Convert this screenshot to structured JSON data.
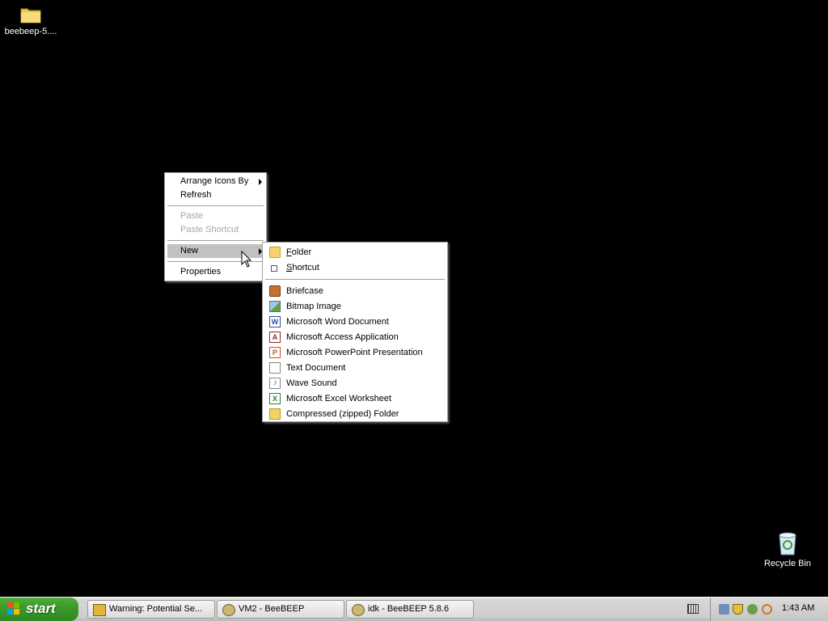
{
  "desktop": {
    "icons": [
      {
        "label": "beebeep-5....",
        "icon": "folder-icon"
      },
      {
        "label": "Recycle Bin",
        "icon": "recycle-bin-icon"
      }
    ]
  },
  "context_menu": {
    "items": [
      {
        "label": "Arrange Icons By",
        "submenu": true,
        "enabled": true
      },
      {
        "label": "Refresh",
        "enabled": true
      },
      {
        "label": "Paste",
        "enabled": false
      },
      {
        "label": "Paste Shortcut",
        "enabled": false
      },
      {
        "label": "New",
        "submenu": true,
        "enabled": true,
        "highlighted": true
      },
      {
        "label": "Properties",
        "enabled": true
      }
    ]
  },
  "new_submenu": {
    "items": [
      {
        "label": "Folder",
        "accel": "F",
        "rest": "older",
        "icon": "folder-icon"
      },
      {
        "label": "Shortcut",
        "accel": "S",
        "rest": "hortcut",
        "icon": "shortcut-icon"
      },
      {
        "label": "Briefcase",
        "icon": "briefcase-icon"
      },
      {
        "label": "Bitmap Image",
        "icon": "bitmap-icon"
      },
      {
        "label": "Microsoft Word Document",
        "icon": "word-icon"
      },
      {
        "label": "Microsoft Access Application",
        "icon": "access-icon"
      },
      {
        "label": "Microsoft PowerPoint Presentation",
        "icon": "powerpoint-icon"
      },
      {
        "label": "Text Document",
        "icon": "text-document-icon"
      },
      {
        "label": "Wave Sound",
        "icon": "wave-sound-icon"
      },
      {
        "label": "Microsoft Excel Worksheet",
        "icon": "excel-icon"
      },
      {
        "label": "Compressed (zipped) Folder",
        "icon": "zip-folder-icon"
      }
    ]
  },
  "taskbar": {
    "start_label": "start",
    "tasks": [
      {
        "label": "Warning: Potential Se...",
        "icon": "warning-icon"
      },
      {
        "label": "VM2 - BeeBEEP",
        "icon": "beebeep-icon"
      },
      {
        "label": "idk - BeeBEEP 5.8.6",
        "icon": "beebeep-icon"
      }
    ],
    "clock": "1:43 AM"
  }
}
